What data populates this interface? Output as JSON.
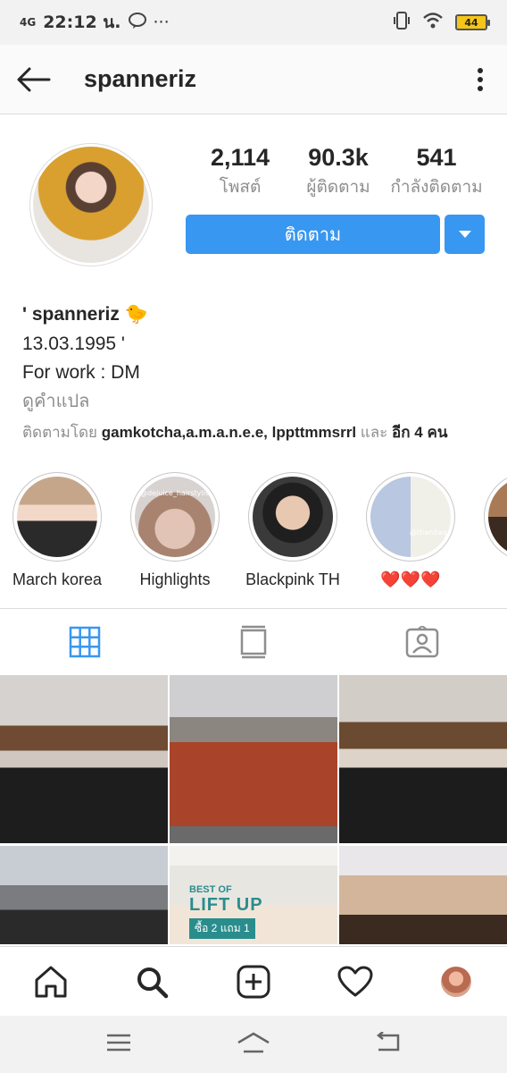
{
  "status": {
    "network": "4G",
    "time": "22:12 น.",
    "app_badge": "LINE",
    "more": "···",
    "battery": "44"
  },
  "header": {
    "username": "spanneriz"
  },
  "stats": {
    "posts_count": "2,114",
    "posts_label": "โพสต์",
    "followers_count": "90.3k",
    "followers_label": "ผู้ติดตาม",
    "following_count": "541",
    "following_label": "กำลังติดตาม"
  },
  "actions": {
    "follow_label": "ติดตาม"
  },
  "bio": {
    "name": "' spanneriz",
    "name_emoji": "🐤",
    "line1": "13.03.1995 '",
    "line2": "For work : DM",
    "translate": "ดูคำแปล",
    "followed_by_prefix": "ติดตามโดย",
    "followed_by_users": "gamkotcha,a.m.a.n.e.e, lppttmmsrrl",
    "followed_by_and": "และ",
    "followed_by_more": "อีก 4 คน"
  },
  "highlights": [
    {
      "label": "March korea"
    },
    {
      "label": "Highlights",
      "overlay": "@dejuice_hairstylist"
    },
    {
      "label": "Blackpink TH"
    },
    {
      "label": "❤️❤️❤️",
      "overlay": "@thanitaq"
    },
    {
      "label": ""
    }
  ],
  "tabs": [
    "grid-view",
    "feed-view",
    "tagged-view"
  ],
  "grid": {
    "promo_title": "BEST OF",
    "promo_lift": "LIFT UP",
    "promo_deal": "ซื้อ 2 แถม 1"
  },
  "colors": {
    "accent": "#3897f0",
    "text": "#262626",
    "muted": "#8e8e8e",
    "border": "#dbdbdb"
  }
}
